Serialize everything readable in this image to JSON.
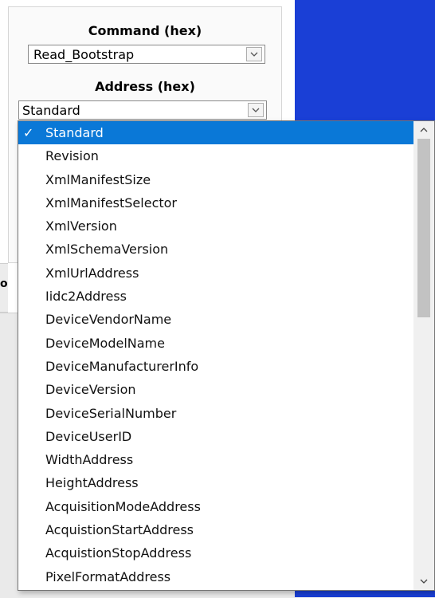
{
  "panel": {
    "command_label": "Command (hex)",
    "command_value": "Read_Bootstrap",
    "address_label": "Address (hex)",
    "address_value": "Standard"
  },
  "left_strip": {
    "text": "o"
  },
  "dropdown": {
    "selected_check": "✓",
    "items": [
      "Standard",
      "Revision",
      "XmlManifestSize",
      "XmlManifestSelector",
      "XmlVersion",
      "XmlSchemaVersion",
      "XmlUrlAddress",
      "Iidc2Address",
      "DeviceVendorName",
      "DeviceModelName",
      "DeviceManufacturerInfo",
      "DeviceVersion",
      "DeviceSerialNumber",
      "DeviceUserID",
      "WidthAddress",
      "HeightAddress",
      "AcquisitionModeAddress",
      "AcquistionStartAddress",
      "AcquistionStopAddress",
      "PixelFormatAddress"
    ]
  },
  "colors": {
    "selection": "#0a78d7",
    "background_right": "#1a3fd6"
  },
  "icons": {
    "combo_arrow": "chevron-down-icon",
    "scroll_up": "chevron-up-icon",
    "scroll_down": "chevron-down-icon"
  }
}
